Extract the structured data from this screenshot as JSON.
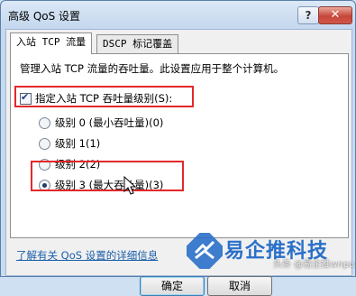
{
  "window": {
    "title": "高级 QoS 设置",
    "help_label": "?",
    "close_label": "✕"
  },
  "tabs": [
    {
      "label": "入站 TCP 流量",
      "active": true
    },
    {
      "label": "DSCP 标记覆盖",
      "active": false
    }
  ],
  "panel": {
    "description": "管理入站 TCP 流量的吞吐量。此设置应用于整个计算机。",
    "checkbox": {
      "label": "指定入站 TCP 吞吐量级别(S):",
      "checked": true
    },
    "radios": [
      {
        "label": "级别 0 (最小吞吐量)(0)",
        "checked": false
      },
      {
        "label": "级别 1(1)",
        "checked": false
      },
      {
        "label": "级别 2(2)",
        "checked": false
      },
      {
        "label": "级别 3 (最大吞吐量)(3)",
        "checked": true
      }
    ]
  },
  "link": "了解有关 QoS 设置的详细信息",
  "buttons": {
    "ok": "确定",
    "cancel": "取消"
  },
  "watermark": {
    "brand": "易企推科技",
    "byline": "头条 @易企推wnpo"
  },
  "colors": {
    "highlight": "#e3282a",
    "link": "#1a5ea8",
    "accent": "#2a6fc9"
  }
}
